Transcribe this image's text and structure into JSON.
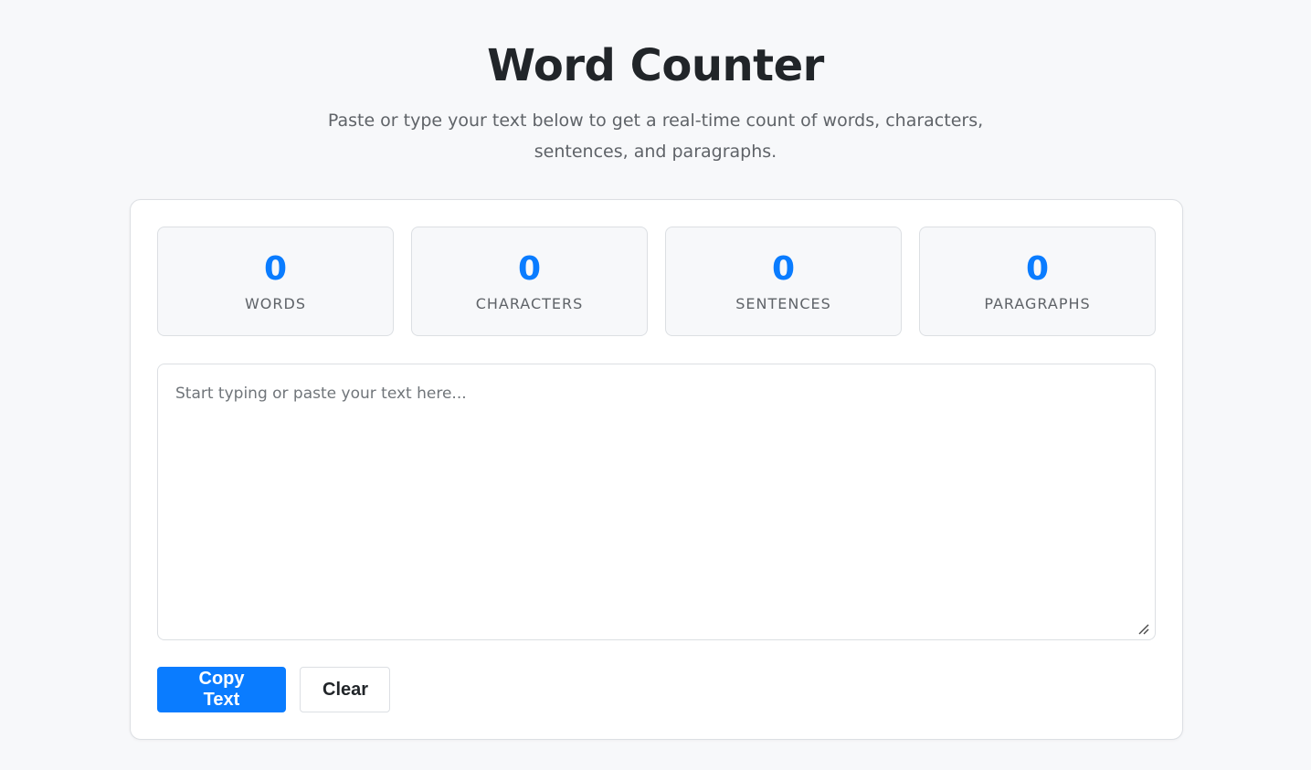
{
  "header": {
    "title": "Word Counter",
    "subtitle": "Paste or type your text below to get a real-time count of words, characters, sentences, and paragraphs."
  },
  "stats": [
    {
      "value": "0",
      "label": "WORDS"
    },
    {
      "value": "0",
      "label": "CHARACTERS"
    },
    {
      "value": "0",
      "label": "SENTENCES"
    },
    {
      "value": "0",
      "label": "PARAGRAPHS"
    }
  ],
  "editor": {
    "value": "",
    "placeholder": "Start typing or paste your text here..."
  },
  "actions": {
    "copy_label": "Copy Text",
    "clear_label": "Clear"
  },
  "colors": {
    "accent": "#0a7cff",
    "background": "#f7f8fa",
    "border": "#dcdfe3",
    "muted_text": "#5f6368"
  },
  "icons": {
    "resize": "resize-grip-icon"
  }
}
